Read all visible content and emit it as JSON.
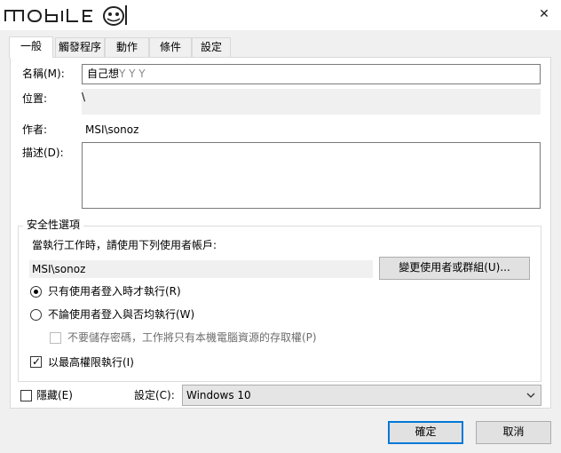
{
  "window": {
    "close_glyph": "✕"
  },
  "tabs": [
    {
      "label": "一般"
    },
    {
      "label": "觸發程序"
    },
    {
      "label": "動作"
    },
    {
      "label": "條件"
    },
    {
      "label": "設定"
    }
  ],
  "general": {
    "name_label": "名稱(M):",
    "name_value": "自己想",
    "name_placeholder": "Y Y Y",
    "location_label": "位置:",
    "location_value": "\\",
    "author_label": "作者:",
    "author_value": "MSI\\sonoz",
    "description_label": "描述(D):",
    "description_value": ""
  },
  "security": {
    "group_title": "安全性選項",
    "run_as_text": "當執行工作時，請使用下列使用者帳戶:",
    "account_value": "MSI\\sonoz",
    "change_user_button": "變更使用者或群組(U)...",
    "radio_logged_on": "只有使用者登入時才執行(R)",
    "radio_logged_on_selected": true,
    "radio_whether": "不論使用者登入與否均執行(W)",
    "radio_whether_selected": false,
    "no_store_password": "不要儲存密碼，工作將只有本機電腦資源的存取權(P)",
    "no_store_password_checked": false,
    "highest_privileges": "以最高權限執行(I)",
    "highest_privileges_checked": true
  },
  "footer": {
    "hidden_label": "隱藏(E)",
    "hidden_checked": false,
    "configure_label": "設定(C):",
    "configure_value": "Windows 10",
    "ok_button": "確定",
    "cancel_button": "取消"
  },
  "icons": {
    "chevron": "chevron-down-icon",
    "check": "check-icon",
    "logo": "mobile01-logo"
  },
  "colors": {
    "accent": "#0078d7",
    "window": "#f0f0f0",
    "panel": "#ffffff"
  }
}
